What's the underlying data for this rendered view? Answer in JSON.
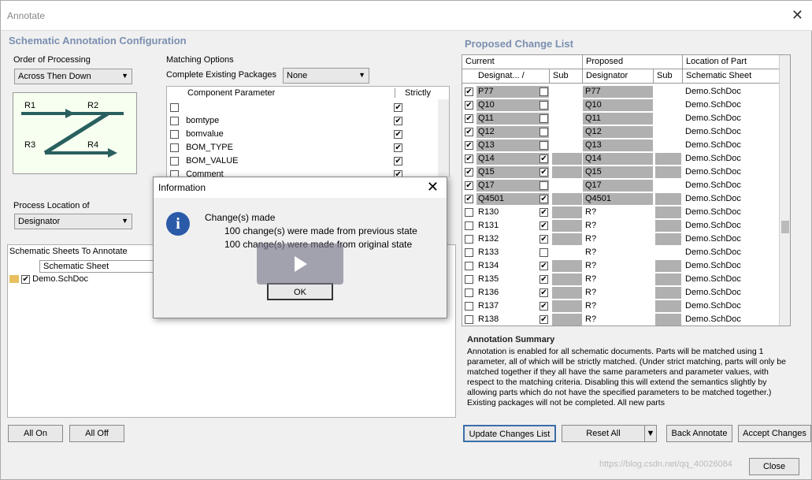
{
  "window": {
    "title": "Annotate"
  },
  "left": {
    "config_title": "Schematic Annotation Configuration",
    "order_label": "Order of Processing",
    "order_value": "Across Then Down",
    "diagram": {
      "r1": "R1",
      "r2": "R2",
      "r3": "R3",
      "r4": "R4"
    },
    "process_loc_label": "Process Location of",
    "process_loc_value": "Designator",
    "sheets_header": "Schematic Sheets To Annotate",
    "sheets_col": "Schematic Sheet",
    "sheet_name": "Demo.SchDoc"
  },
  "matching": {
    "label": "Matching Options",
    "complete_label": "Complete Existing Packages",
    "complete_value": "None",
    "col_param": "Component Parameter",
    "col_strictly": "Strictly",
    "rows": [
      {
        "name": "",
        "checked": false,
        "strict": true
      },
      {
        "name": "bomtype",
        "checked": false,
        "strict": true
      },
      {
        "name": "bomvalue",
        "checked": false,
        "strict": true
      },
      {
        "name": "BOM_TYPE",
        "checked": false,
        "strict": true
      },
      {
        "name": "BOM_VALUE",
        "checked": false,
        "strict": true
      },
      {
        "name": "Comment",
        "checked": false,
        "strict": true
      }
    ]
  },
  "proposed": {
    "title": "Proposed Change List",
    "group_current": "Current",
    "group_proposed": "Proposed",
    "group_location": "Location of Part",
    "col_designator": "Designat... /",
    "col_sub": "Sub",
    "col_p_designator": "Designator",
    "col_p_sub": "Sub",
    "col_sheet": "Schematic Sheet",
    "rows": [
      {
        "chk": true,
        "cur": "P77",
        "sub": false,
        "prop": "P77",
        "sheet": "Demo.SchDoc",
        "hl": true,
        "subhl": false
      },
      {
        "chk": true,
        "cur": "Q10",
        "sub": false,
        "prop": "Q10",
        "sheet": "Demo.SchDoc",
        "hl": true,
        "subhl": false
      },
      {
        "chk": true,
        "cur": "Q11",
        "sub": false,
        "prop": "Q11",
        "sheet": "Demo.SchDoc",
        "hl": true,
        "subhl": false
      },
      {
        "chk": true,
        "cur": "Q12",
        "sub": false,
        "prop": "Q12",
        "sheet": "Demo.SchDoc",
        "hl": true,
        "subhl": false
      },
      {
        "chk": true,
        "cur": "Q13",
        "sub": false,
        "prop": "Q13",
        "sheet": "Demo.SchDoc",
        "hl": true,
        "subhl": false
      },
      {
        "chk": true,
        "cur": "Q14",
        "sub": true,
        "prop": "Q14",
        "sheet": "Demo.SchDoc",
        "hl": true,
        "subhl": true
      },
      {
        "chk": true,
        "cur": "Q15",
        "sub": true,
        "prop": "Q15",
        "sheet": "Demo.SchDoc",
        "hl": true,
        "subhl": true
      },
      {
        "chk": true,
        "cur": "Q17",
        "sub": false,
        "prop": "Q17",
        "sheet": "Demo.SchDoc",
        "hl": true,
        "subhl": false
      },
      {
        "chk": true,
        "cur": "Q4501",
        "sub": true,
        "prop": "Q4501",
        "sheet": "Demo.SchDoc",
        "hl": true,
        "subhl": true
      },
      {
        "chk": false,
        "cur": "R130",
        "sub": true,
        "prop": "R?",
        "sheet": "Demo.SchDoc",
        "hl": false,
        "subhl": true
      },
      {
        "chk": false,
        "cur": "R131",
        "sub": true,
        "prop": "R?",
        "sheet": "Demo.SchDoc",
        "hl": false,
        "subhl": true
      },
      {
        "chk": false,
        "cur": "R132",
        "sub": true,
        "prop": "R?",
        "sheet": "Demo.SchDoc",
        "hl": false,
        "subhl": true
      },
      {
        "chk": false,
        "cur": "R133",
        "sub": false,
        "prop": "R?",
        "sheet": "Demo.SchDoc",
        "hl": false,
        "subhl": false
      },
      {
        "chk": false,
        "cur": "R134",
        "sub": true,
        "prop": "R?",
        "sheet": "Demo.SchDoc",
        "hl": false,
        "subhl": true
      },
      {
        "chk": false,
        "cur": "R135",
        "sub": true,
        "prop": "R?",
        "sheet": "Demo.SchDoc",
        "hl": false,
        "subhl": true
      },
      {
        "chk": false,
        "cur": "R136",
        "sub": true,
        "prop": "R?",
        "sheet": "Demo.SchDoc",
        "hl": false,
        "subhl": true
      },
      {
        "chk": false,
        "cur": "R137",
        "sub": true,
        "prop": "R?",
        "sheet": "Demo.SchDoc",
        "hl": false,
        "subhl": true
      },
      {
        "chk": false,
        "cur": "R138",
        "sub": true,
        "prop": "R?",
        "sheet": "Demo.SchDoc",
        "hl": false,
        "subhl": true
      }
    ]
  },
  "summary": {
    "title": "Annotation Summary",
    "text": "Annotation is enabled for all schematic documents. Parts will be matched using 1 parameter, all of which will be strictly matched. (Under strict matching, parts will only be matched together if they all have the same parameters and parameter values, with respect to the matching criteria. Disabling this will extend the semantics slightly by allowing parts which do not have the specified parameters to be matched together.) Existing packages will not be completed. All new parts"
  },
  "buttons": {
    "all_on": "All On",
    "all_off": "All Off",
    "update": "Update Changes List",
    "reset": "Reset All",
    "back": "Back Annotate",
    "accept": "Accept Changes",
    "close": "Close"
  },
  "dialog": {
    "title": "Information",
    "line1": "Change(s) made",
    "line2": "100 change(s) were made from previous state",
    "line3": "100 change(s) were made from original state",
    "ok": "OK"
  },
  "watermark": "https://blog.csdn.net/qq_40026084"
}
